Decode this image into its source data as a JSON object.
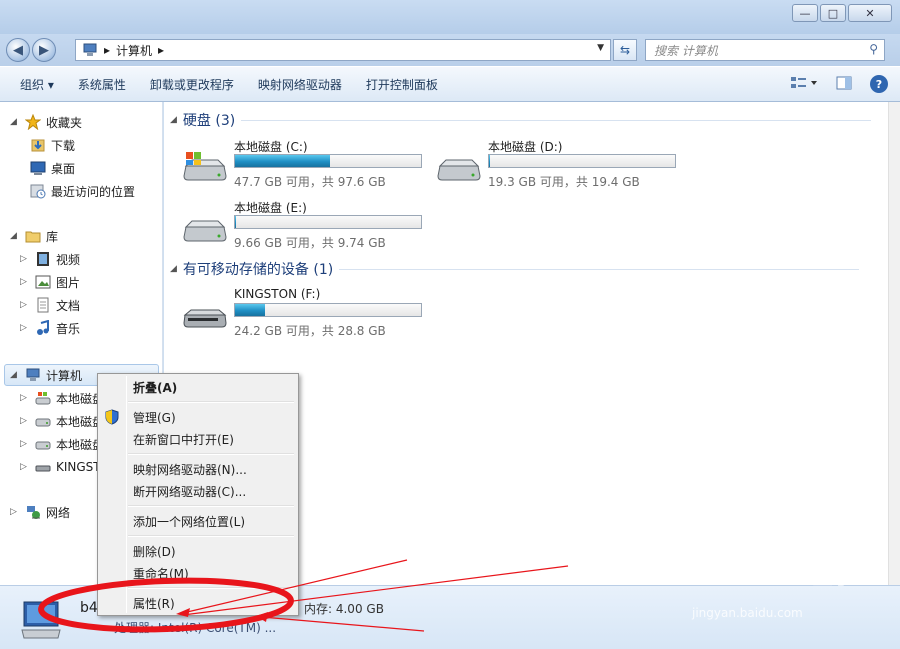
{
  "window": {
    "minimize_glyph": "—",
    "maximize_glyph": "□",
    "close_glyph": "✕"
  },
  "address": {
    "crumbs": [
      "▸",
      "计算机",
      "▸"
    ],
    "search_placeholder": "搜索 计算机"
  },
  "toolbar": {
    "items": [
      "组织 ▾",
      "系统属性",
      "卸载或更改程序",
      "映射网络驱动器",
      "打开控制面板"
    ]
  },
  "nav": {
    "favorites": "收藏夹",
    "downloads": "下载",
    "desktop": "桌面",
    "recent": "最近访问的位置",
    "libraries": "库",
    "videos": "视频",
    "pictures": "图片",
    "documents": "文档",
    "music": "音乐",
    "computer": "计算机",
    "disk_c": "本地磁盘",
    "disk_d": "本地磁盘",
    "disk_e": "本地磁盘",
    "kingston": "KINGST",
    "network": "网络"
  },
  "content": {
    "hard_disks_heading": "硬盘 (3)",
    "removable_heading": "有可移动存储的设备 (1)",
    "drives": [
      {
        "name": "本地磁盘 (C:)",
        "free": "47.7 GB 可用，共 97.6 GB",
        "used_fraction": 0.51
      },
      {
        "name": "本地磁盘 (D:)",
        "free": "19.3 GB 可用，共 19.4 GB",
        "used_fraction": 0.005
      },
      {
        "name": "本地磁盘 (E:)",
        "free": "9.66 GB 可用，共 9.74 GB",
        "used_fraction": 0.008
      },
      {
        "name": "KINGSTON (F:)",
        "free": "24.2 GB 可用，共 28.8 GB",
        "used_fraction": 0.16
      }
    ]
  },
  "details": {
    "pc_name": "b4-",
    "memory": "内存: 4.00 GB",
    "cpu": "处理器: Intel(R) Core(TM) ..."
  },
  "context_menu": {
    "collapse": "折叠(A)",
    "manage": "管理(G)",
    "open_new_window": "在新窗口中打开(E)",
    "map_drive": "映射网络驱动器(N)...",
    "disconnect_drive": "断开网络驱动器(C)...",
    "add_network_location": "添加一个网络位置(L)",
    "delete": "删除(D)",
    "rename": "重命名(M)",
    "properties": "属性(R)"
  },
  "watermark": {
    "brand": "Baidu 经验",
    "url": "jingyan.baidu.com"
  },
  "colors": {
    "annotation_red": "#e8151b",
    "bar_fill": "#1f8fc4"
  }
}
